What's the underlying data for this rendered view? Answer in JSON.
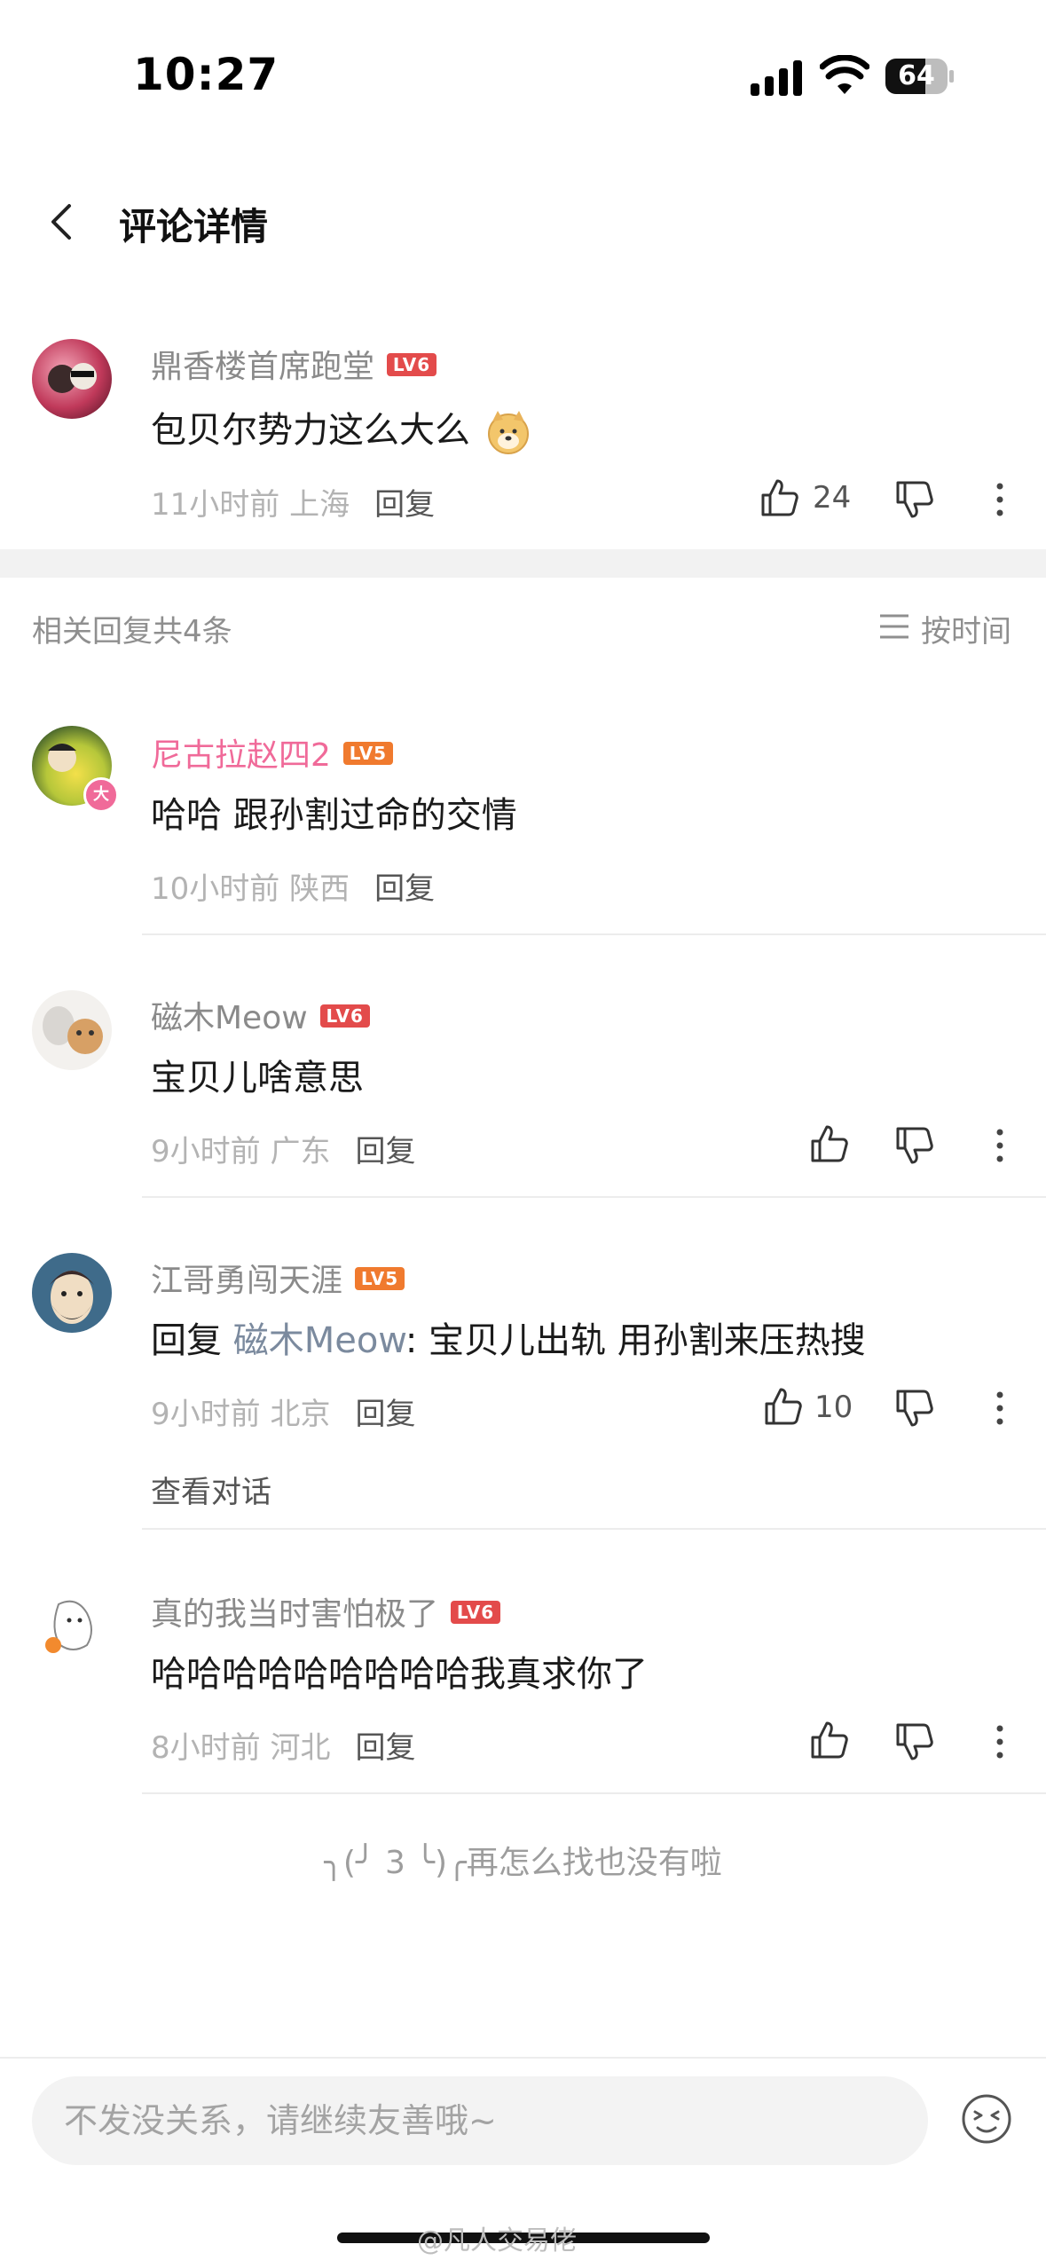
{
  "status_bar": {
    "time": "10:27",
    "battery": "64",
    "battery_level": 0.64
  },
  "header": {
    "title": "评论详情"
  },
  "main_comment": {
    "user": "鼎香楼首席跑堂",
    "level": "LV6",
    "text": "包贝尔势力这么大么",
    "emoji": "doge-emoji",
    "time": "11小时前",
    "location": "上海",
    "reply_label": "回复",
    "likes": "24"
  },
  "replies_section": {
    "count_label": "相关回复共4条",
    "sort_label": "按时间"
  },
  "replies": [
    {
      "user": "尼古拉赵四2",
      "level": "LV5",
      "text": "哈哈 跟孙割过命的交情",
      "time": "10小时前",
      "location": "陕西",
      "reply_label": "回复",
      "badge": "大"
    },
    {
      "user": "磁木Meow",
      "level": "LV6",
      "text": "宝贝儿啥意思",
      "time": "9小时前",
      "location": "广东",
      "reply_label": "回复"
    },
    {
      "user": "江哥勇闯天涯",
      "level": "LV5",
      "reply_prefix": "回复",
      "mention": "磁木Meow",
      "text": ": 宝贝儿出轨 用孙割来压热搜",
      "time": "9小时前",
      "location": "北京",
      "reply_label": "回复",
      "likes": "10",
      "view_conversation": "查看对话"
    },
    {
      "user": "真的我当时害怕极了",
      "level": "LV6",
      "text": "哈哈哈哈哈哈哈哈哈我真求你了",
      "time": "8小时前",
      "location": "河北",
      "reply_label": "回复"
    }
  ],
  "end_note": "╮(╯ 3 ╰)╭再怎么找也没有啦",
  "input": {
    "placeholder": "不发没关系，请继续友善哦~"
  },
  "watermark": "@凡人交易佬",
  "colors": {
    "level6": "#e34b4b",
    "level5": "#f07a2e",
    "highlight_name": "#f06a99"
  }
}
